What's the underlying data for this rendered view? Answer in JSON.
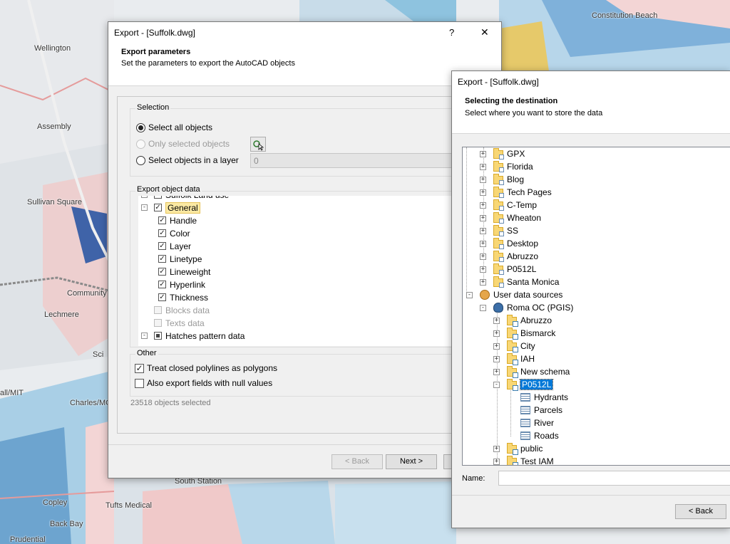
{
  "map": {
    "labels": [
      "Wellington",
      "Assembly",
      "Sullivan Square",
      "Lechmere",
      "Community",
      "Charles/MGH",
      "all/MIT",
      "Sci",
      "Constitution Beach",
      "South Station",
      "Tufts Medical",
      "Back Bay",
      "Prudential",
      "Copley"
    ]
  },
  "export_dialog": {
    "title": "Export - [Suffolk.dwg]",
    "help": "?",
    "close": "✕",
    "header_title": "Export parameters",
    "header_subtitle": "Set the parameters to export the AutoCAD objects",
    "selection": {
      "label": "Selection",
      "select_all": "Select all objects",
      "only_selected": "Only selected objects",
      "in_layer": "Select objects in a layer",
      "layer_value": "0"
    },
    "object_data": {
      "label": "Export object data",
      "items": [
        {
          "label": "Suffolk Land use",
          "checked": true,
          "disabled": false,
          "partial": false,
          "expander": "+"
        },
        {
          "label": "General",
          "checked": true,
          "disabled": false,
          "partial": false,
          "expander": "−"
        },
        {
          "label": "Handle",
          "checked": true,
          "disabled": false,
          "partial": false,
          "expander": ""
        },
        {
          "label": "Color",
          "checked": true,
          "disabled": false,
          "partial": false,
          "expander": ""
        },
        {
          "label": "Layer",
          "checked": true,
          "disabled": false,
          "partial": false,
          "expander": ""
        },
        {
          "label": "Linetype",
          "checked": true,
          "disabled": false,
          "partial": false,
          "expander": ""
        },
        {
          "label": "Lineweight",
          "checked": true,
          "disabled": false,
          "partial": false,
          "expander": ""
        },
        {
          "label": "Hyperlink",
          "checked": true,
          "disabled": false,
          "partial": false,
          "expander": ""
        },
        {
          "label": "Thickness",
          "checked": true,
          "disabled": false,
          "partial": false,
          "expander": ""
        },
        {
          "label": "Blocks data",
          "checked": false,
          "disabled": true,
          "partial": false,
          "expander": ""
        },
        {
          "label": "Texts data",
          "checked": false,
          "disabled": true,
          "partial": false,
          "expander": ""
        },
        {
          "label": "Hatches pattern data",
          "checked": false,
          "disabled": false,
          "partial": true,
          "expander": "−"
        }
      ]
    },
    "other": {
      "label": "Other",
      "closed_polylines": "Treat closed polylines as polygons",
      "closed_polylines_checked": true,
      "null_values": "Also export fields with null values",
      "null_values_checked": false
    },
    "status": "23518 objects selected",
    "back": "< Back",
    "next": "Next >"
  },
  "dest_dialog": {
    "title": "Export - [Suffolk.dwg]",
    "header_title": "Selecting the destination",
    "header_subtitle": "Select where you want to store the data",
    "folders": [
      "GPX",
      "Florida",
      "Blog",
      "Tech Pages",
      "C-Temp",
      "Wheaton",
      "SS",
      "Desktop",
      "Abruzzo",
      "P0512L",
      "Santa Monica"
    ],
    "user_sources": "User data sources",
    "server": "Roma OC (PGIS)",
    "schemas_before": [
      "Abruzzo",
      "Bismarck",
      "City",
      "IAH",
      "New schema"
    ],
    "selected_schema": "P0512L",
    "tables": [
      "Hydrants",
      "Parcels",
      "River",
      "Roads"
    ],
    "schemas_after": [
      "public",
      "Test IAM"
    ],
    "name_label": "Name:",
    "name_value": "",
    "back": "< Back"
  }
}
